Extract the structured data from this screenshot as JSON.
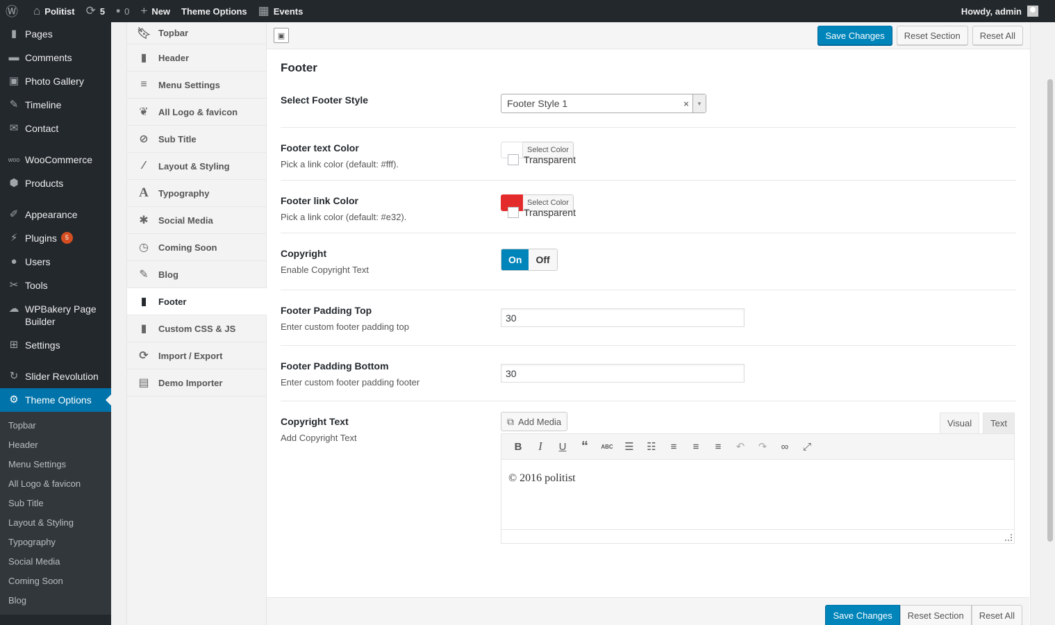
{
  "adminbar": {
    "site_name": "Politist",
    "updates_count": "5",
    "comments_count": "0",
    "new_label": "New",
    "theme_options_label": "Theme Options",
    "events_label": "Events",
    "howdy": "Howdy, admin"
  },
  "adminmenu": {
    "items": [
      {
        "label": "Pages",
        "icon": "pages-icon"
      },
      {
        "label": "Comments",
        "icon": "comments-icon"
      },
      {
        "label": "Photo Gallery",
        "icon": "gallery-icon"
      },
      {
        "label": "Timeline",
        "icon": "timeline-icon"
      },
      {
        "label": "Contact",
        "icon": "mail-icon"
      },
      {
        "label": "WooCommerce",
        "icon": "woocommerce-icon"
      },
      {
        "label": "Products",
        "icon": "products-icon"
      },
      {
        "label": "Appearance",
        "icon": "appearance-icon"
      },
      {
        "label": "Plugins",
        "icon": "plugins-icon",
        "badge": "5"
      },
      {
        "label": "Users",
        "icon": "users-icon"
      },
      {
        "label": "Tools",
        "icon": "tools-icon"
      },
      {
        "label": "WPBakery Page Builder",
        "icon": "wpbakery-icon"
      },
      {
        "label": "Settings",
        "icon": "settings-icon"
      },
      {
        "label": "Slider Revolution",
        "icon": "slider-icon"
      },
      {
        "label": "Theme Options",
        "icon": "gear-icon",
        "current": true
      }
    ],
    "submenu": [
      "Topbar",
      "Header",
      "Menu Settings",
      "All Logo & favicon",
      "Sub Title",
      "Layout & Styling",
      "Typography",
      "Social Media",
      "Coming Soon",
      "Blog"
    ]
  },
  "optnav": {
    "items": [
      {
        "label": "Topbar",
        "icon": "bookmark-icon"
      },
      {
        "label": "Header",
        "icon": "bookmark-icon"
      },
      {
        "label": "Menu Settings",
        "icon": "menu-icon"
      },
      {
        "label": "All Logo & favicon",
        "icon": "leaf-icon"
      },
      {
        "label": "Sub Title",
        "icon": "compass-icon"
      },
      {
        "label": "Layout & Styling",
        "icon": "brush-icon"
      },
      {
        "label": "Typography",
        "icon": "typography-icon"
      },
      {
        "label": "Social Media",
        "icon": "star-icon"
      },
      {
        "label": "Coming Soon",
        "icon": "clock-icon"
      },
      {
        "label": "Blog",
        "icon": "edit-icon"
      },
      {
        "label": "Footer",
        "icon": "bookmark-icon",
        "active": true
      },
      {
        "label": "Custom CSS & JS",
        "icon": "bookmark-icon"
      },
      {
        "label": "Import / Export",
        "icon": "refresh-icon"
      },
      {
        "label": "Demo Importer",
        "icon": "importer-icon"
      }
    ]
  },
  "toolbar": {
    "save_label": "Save Changes",
    "reset_section_label": "Reset Section",
    "reset_all_label": "Reset All"
  },
  "section": {
    "title": "Footer",
    "footer_style": {
      "label": "Select Footer Style",
      "value": "Footer Style 1"
    },
    "text_color": {
      "label": "Footer text Color",
      "desc": "Pick a link color (default: #fff).",
      "button": "Select Color",
      "transparent": "Transparent",
      "swatch": "#ffffff"
    },
    "link_color": {
      "label": "Footer link Color",
      "desc": "Pick a link color (default: #e32).",
      "button": "Select Color",
      "transparent": "Transparent",
      "swatch": "#e32b2b"
    },
    "copyright": {
      "label": "Copyright",
      "desc": "Enable Copyright Text",
      "on": "On",
      "off": "Off"
    },
    "padding_top": {
      "label": "Footer Padding Top",
      "desc": "Enter custom footer padding top",
      "value": "30"
    },
    "padding_bottom": {
      "label": "Footer Padding Bottom",
      "desc": "Enter custom footer padding footer",
      "value": "30"
    },
    "copyright_text": {
      "label": "Copyright Text",
      "desc": "Add Copyright Text",
      "add_media": "Add Media",
      "tab_visual": "Visual",
      "tab_text": "Text",
      "content": "© 2016 politist"
    }
  }
}
